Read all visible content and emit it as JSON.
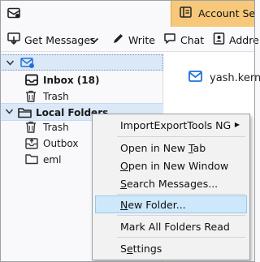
{
  "tabs": {
    "mail_tab_icon": "mail-tab-icon",
    "account_tab": {
      "icon": "account-settings-icon",
      "label": "Account Sett"
    }
  },
  "toolbar": {
    "get_messages": "Get Messages",
    "write": "Write",
    "chat": "Chat",
    "address_book": "Addre"
  },
  "folders": {
    "account_label": "",
    "inbox": {
      "label": "Inbox",
      "count": "(18)"
    },
    "trash": "Trash",
    "local_folders": "Local Folders",
    "local_trash": "Trash",
    "outbox": "Outbox",
    "eml": "eml"
  },
  "account_pane": {
    "email": "yash.kern"
  },
  "context_menu": {
    "items": [
      {
        "label": "ImportExportTools NG",
        "submenu": true
      },
      {
        "pre": "Open in New ",
        "u": "T",
        "post": "ab"
      },
      {
        "pre": "",
        "u": "O",
        "post": "pen in New Window"
      },
      {
        "pre": "",
        "u": "S",
        "post": "earch Messages..."
      },
      {
        "pre": "",
        "u": "N",
        "post": "ew Folder...",
        "highlighted": true
      },
      {
        "label": "Mark All Folders Read"
      },
      {
        "pre": "S",
        "u": "e",
        "post": "ttings"
      }
    ]
  },
  "colors": {
    "account_tab_bg": "#f7c87a",
    "selection_bg": "#dbe8f7",
    "menu_highlight": "#cde8fb",
    "accent_blue": "#1e73d8"
  }
}
